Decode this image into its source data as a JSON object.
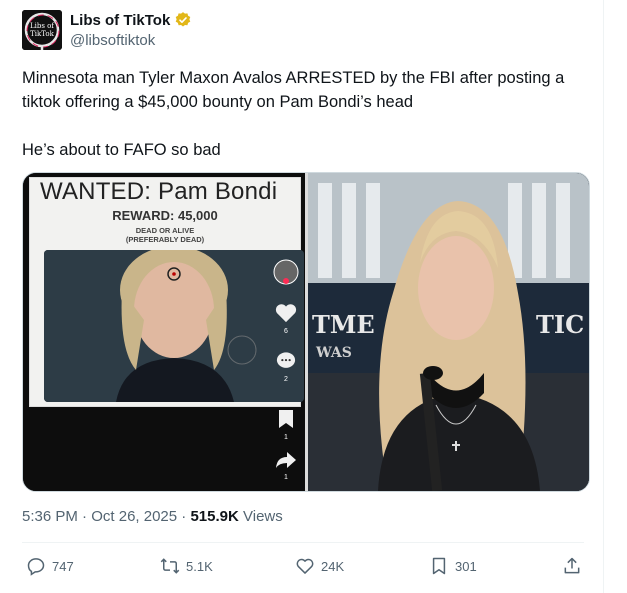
{
  "author": {
    "display_name": "Libs of TikTok",
    "handle": "@libsoftiktok",
    "avatar_text": [
      "Libs of",
      "TikTok"
    ],
    "verified_badge_color": "#e2b719"
  },
  "tweet": {
    "text_line1": "Minnesota man Tyler Maxon Avalos ARRESTED by the FBI after posting a tiktok offering a $45,000 bounty on Pam Bondi’s head",
    "text_line2": "He’s about to FAFO so bad"
  },
  "media": {
    "poster_title": "WANTED: Pam Bondi",
    "poster_reward": "REWARD: 45,000",
    "poster_sub1": "DEAD OR ALIVE",
    "poster_sub2": "(PREFERABLY DEAD)",
    "tiktok_counts": [
      "6",
      "2",
      "1",
      "1"
    ],
    "banner_left": "TME",
    "banner_left2": "WAS",
    "banner_right": "TIC"
  },
  "meta": {
    "time": "5:36 PM",
    "date": "Oct 26, 2025",
    "views_count": "515.9K",
    "views_label": "Views"
  },
  "actions": {
    "replies": "747",
    "reposts": "5.1K",
    "likes": "24K",
    "bookmarks": "301"
  },
  "colors": {
    "text": "#0f1419",
    "secondary": "#536471",
    "border": "#cfd9de"
  }
}
